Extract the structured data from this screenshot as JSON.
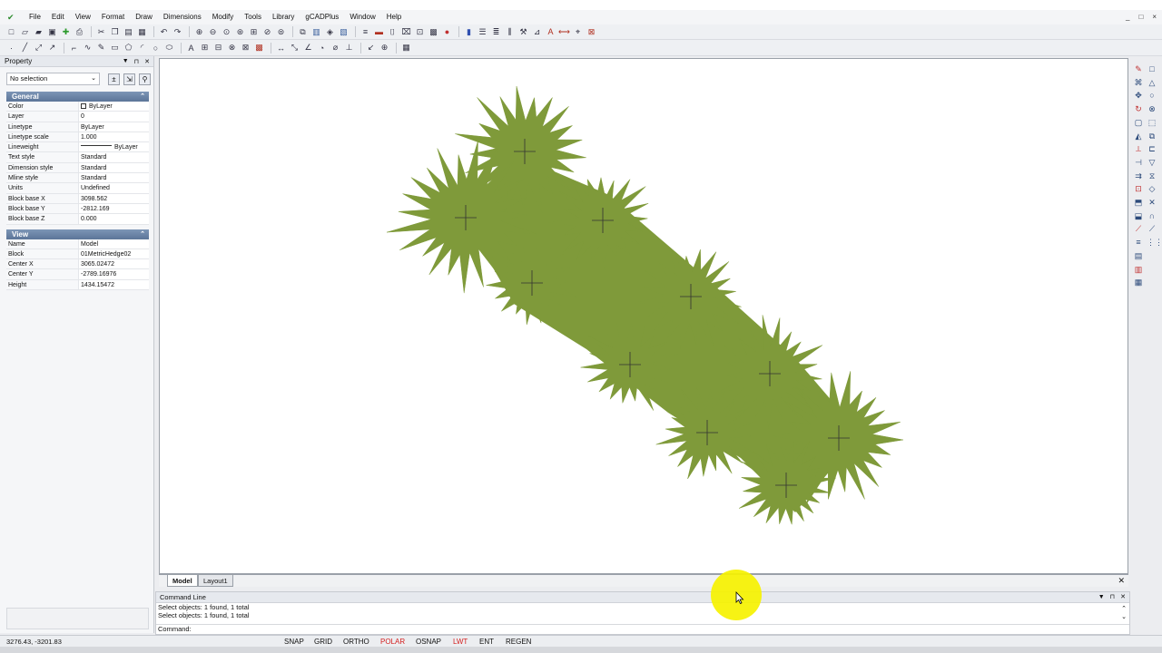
{
  "menu": {
    "items": [
      "File",
      "Edit",
      "View",
      "Format",
      "Draw",
      "Dimensions",
      "Modify",
      "Tools",
      "Library",
      "gCADPlus",
      "Window",
      "Help"
    ],
    "window_controls": [
      "_",
      "□",
      "×"
    ]
  },
  "property": {
    "title": "Property",
    "selection": "No selection",
    "general_title": "General",
    "general": [
      {
        "k": "Color",
        "v": "ByLayer"
      },
      {
        "k": "Layer",
        "v": "0"
      },
      {
        "k": "Linetype",
        "v": "ByLayer"
      },
      {
        "k": "Linetype scale",
        "v": "1.000"
      },
      {
        "k": "Lineweight",
        "v": "ByLayer"
      },
      {
        "k": "Text style",
        "v": "Standard"
      },
      {
        "k": "Dimension style",
        "v": "Standard"
      },
      {
        "k": "Mline style",
        "v": "Standard"
      },
      {
        "k": "Units",
        "v": "Undefined"
      },
      {
        "k": "Block base X",
        "v": "3098.562"
      },
      {
        "k": "Block base Y",
        "v": "-2812.169"
      },
      {
        "k": "Block base Z",
        "v": "0.000"
      }
    ],
    "view_title": "View",
    "view": [
      {
        "k": "Name",
        "v": "Model"
      },
      {
        "k": "Block",
        "v": "01MetricHedge02"
      },
      {
        "k": "Center X",
        "v": "3065.02472"
      },
      {
        "k": "Center Y",
        "v": "-2789.16976"
      },
      {
        "k": "Height",
        "v": "1434.15472"
      }
    ]
  },
  "tabs": {
    "model": "Model",
    "layout": "Layout1"
  },
  "command": {
    "title": "Command Line",
    "lines": [
      "Select objects: 1 found,  1 total",
      "Select objects: 1 found,  1 total"
    ],
    "prompt": "Command:"
  },
  "status": {
    "coords": "3276.43, -3201.83",
    "buttons": [
      "SNAP",
      "GRID",
      "ORTHO",
      "POLAR",
      "OSNAP",
      "LWT",
      "ENT",
      "REGEN"
    ],
    "active": [
      "POLAR",
      "LWT"
    ],
    "active_color": "#d42020"
  },
  "drawing": {
    "fill_color": "#7f9a3a",
    "outline_color": "#333333"
  }
}
